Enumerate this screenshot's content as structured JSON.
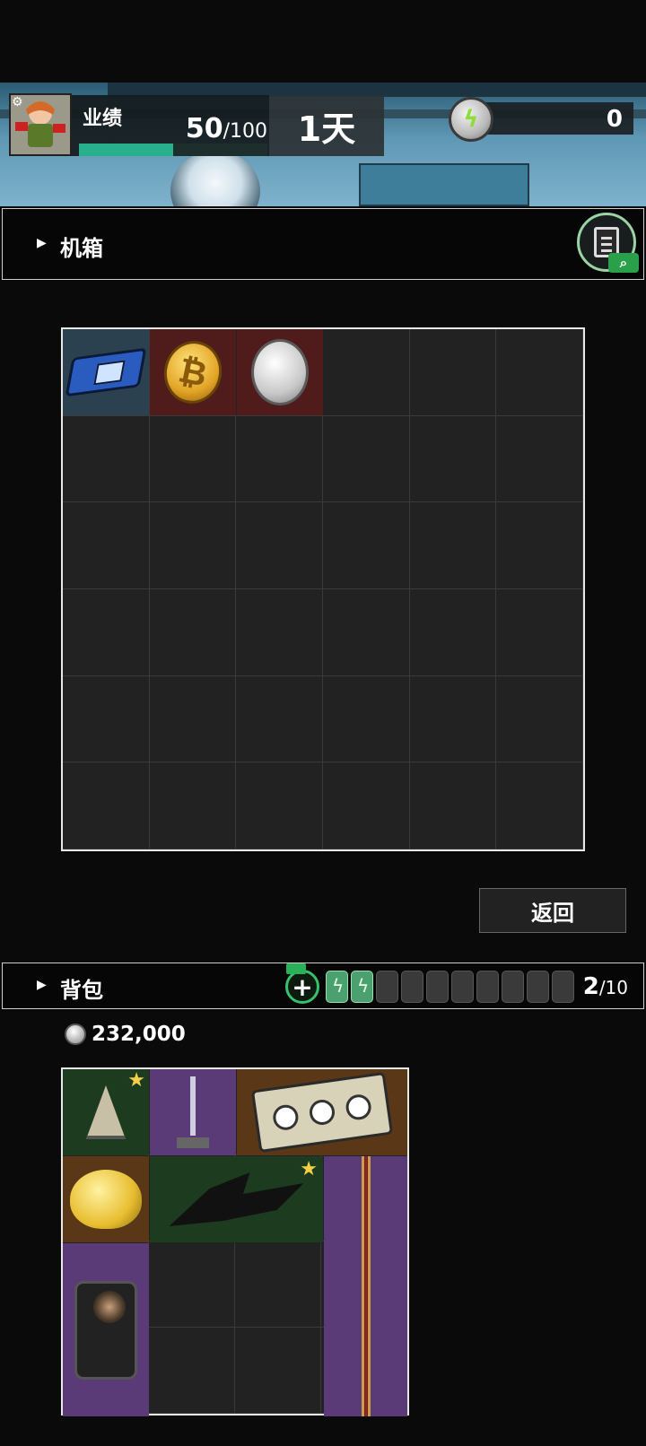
{
  "hud": {
    "performance_label": "业绩",
    "performance_current": "50",
    "performance_max": "/100",
    "performance_fraction": 0.5,
    "day_label": "1天",
    "currency_value": "0"
  },
  "chest": {
    "title": "机箱",
    "return_label": "返回",
    "items": [
      {
        "name": "ssd-drive",
        "color": "#2c4150"
      },
      {
        "name": "gold-bitcoin",
        "color": "#4f1b1b"
      },
      {
        "name": "silver-coin",
        "color": "#4f1b1b"
      }
    ]
  },
  "backpack": {
    "title": "背包",
    "slot_used": "2",
    "slot_total": "/10",
    "batteries_filled": 2,
    "batteries_total": 10,
    "money": "232,000"
  },
  "colors": {
    "accent_green": "#28b08a",
    "grid_border": "#e8e8e8",
    "rarity_blue": "#2c4150",
    "rarity_red": "#4f1b1b",
    "rarity_green": "#1d3c1f",
    "rarity_purple": "#5b3a78",
    "rarity_brown": "#5a3716"
  }
}
